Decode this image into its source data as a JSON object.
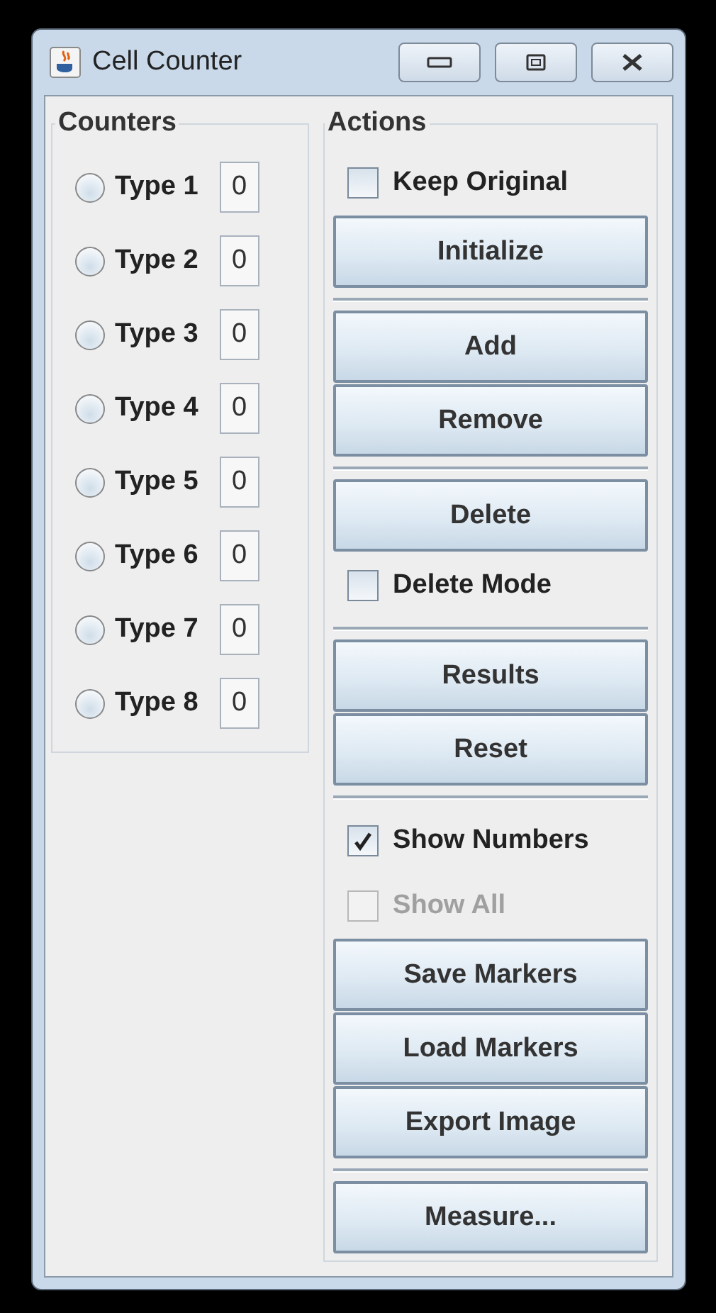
{
  "window": {
    "title": "Cell Counter"
  },
  "counters": {
    "title": "Counters",
    "items": [
      {
        "label": "Type 1",
        "count": "0",
        "selected": false
      },
      {
        "label": "Type 2",
        "count": "0",
        "selected": false
      },
      {
        "label": "Type 3",
        "count": "0",
        "selected": false
      },
      {
        "label": "Type 4",
        "count": "0",
        "selected": false
      },
      {
        "label": "Type 5",
        "count": "0",
        "selected": false
      },
      {
        "label": "Type 6",
        "count": "0",
        "selected": false
      },
      {
        "label": "Type 7",
        "count": "0",
        "selected": false
      },
      {
        "label": "Type 8",
        "count": "0",
        "selected": false
      }
    ]
  },
  "actions": {
    "title": "Actions",
    "items": [
      {
        "kind": "checkbox",
        "label": "Keep Original",
        "checked": false,
        "disabled": false
      },
      {
        "kind": "button",
        "label": "Initialize"
      },
      {
        "kind": "separator"
      },
      {
        "kind": "button",
        "label": "Add"
      },
      {
        "kind": "button",
        "label": "Remove"
      },
      {
        "kind": "separator"
      },
      {
        "kind": "button",
        "label": "Delete"
      },
      {
        "kind": "checkbox",
        "label": "Delete Mode",
        "checked": false,
        "disabled": false
      },
      {
        "kind": "separator"
      },
      {
        "kind": "button",
        "label": "Results"
      },
      {
        "kind": "button",
        "label": "Reset"
      },
      {
        "kind": "separator"
      },
      {
        "kind": "checkbox",
        "label": "Show Numbers",
        "checked": true,
        "disabled": false
      },
      {
        "kind": "checkbox",
        "label": "Show All",
        "checked": false,
        "disabled": true
      },
      {
        "kind": "button",
        "label": "Save Markers"
      },
      {
        "kind": "button",
        "label": "Load Markers"
      },
      {
        "kind": "button",
        "label": "Export Image"
      },
      {
        "kind": "separator"
      },
      {
        "kind": "button",
        "label": "Measure..."
      }
    ]
  }
}
